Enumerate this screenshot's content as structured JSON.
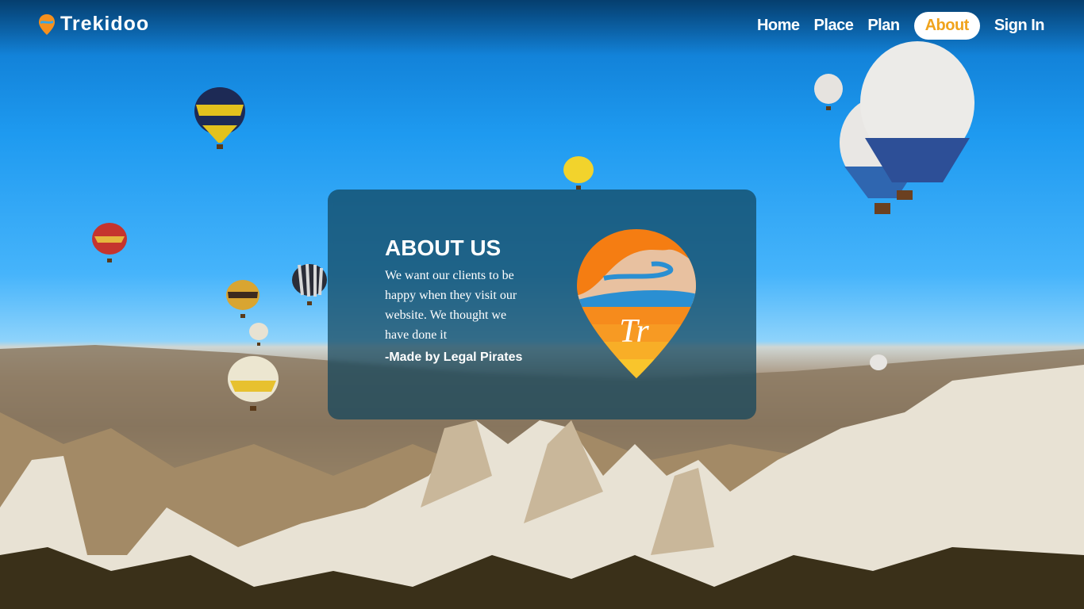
{
  "brand": {
    "name": "Trekidoo",
    "icon": "map-pin-icon"
  },
  "nav": {
    "home": "Home",
    "place": "Place",
    "plan": "Plan",
    "about": "About",
    "signin": "Sign In"
  },
  "about": {
    "title": "ABOUT US",
    "body": "We want our clients to be happy when they visit our website. We thought we have done it",
    "signature": "-Made by Legal Pirates",
    "logo_text": "Tr"
  },
  "colors": {
    "accent": "#f0a31c",
    "card": "#10445c"
  }
}
